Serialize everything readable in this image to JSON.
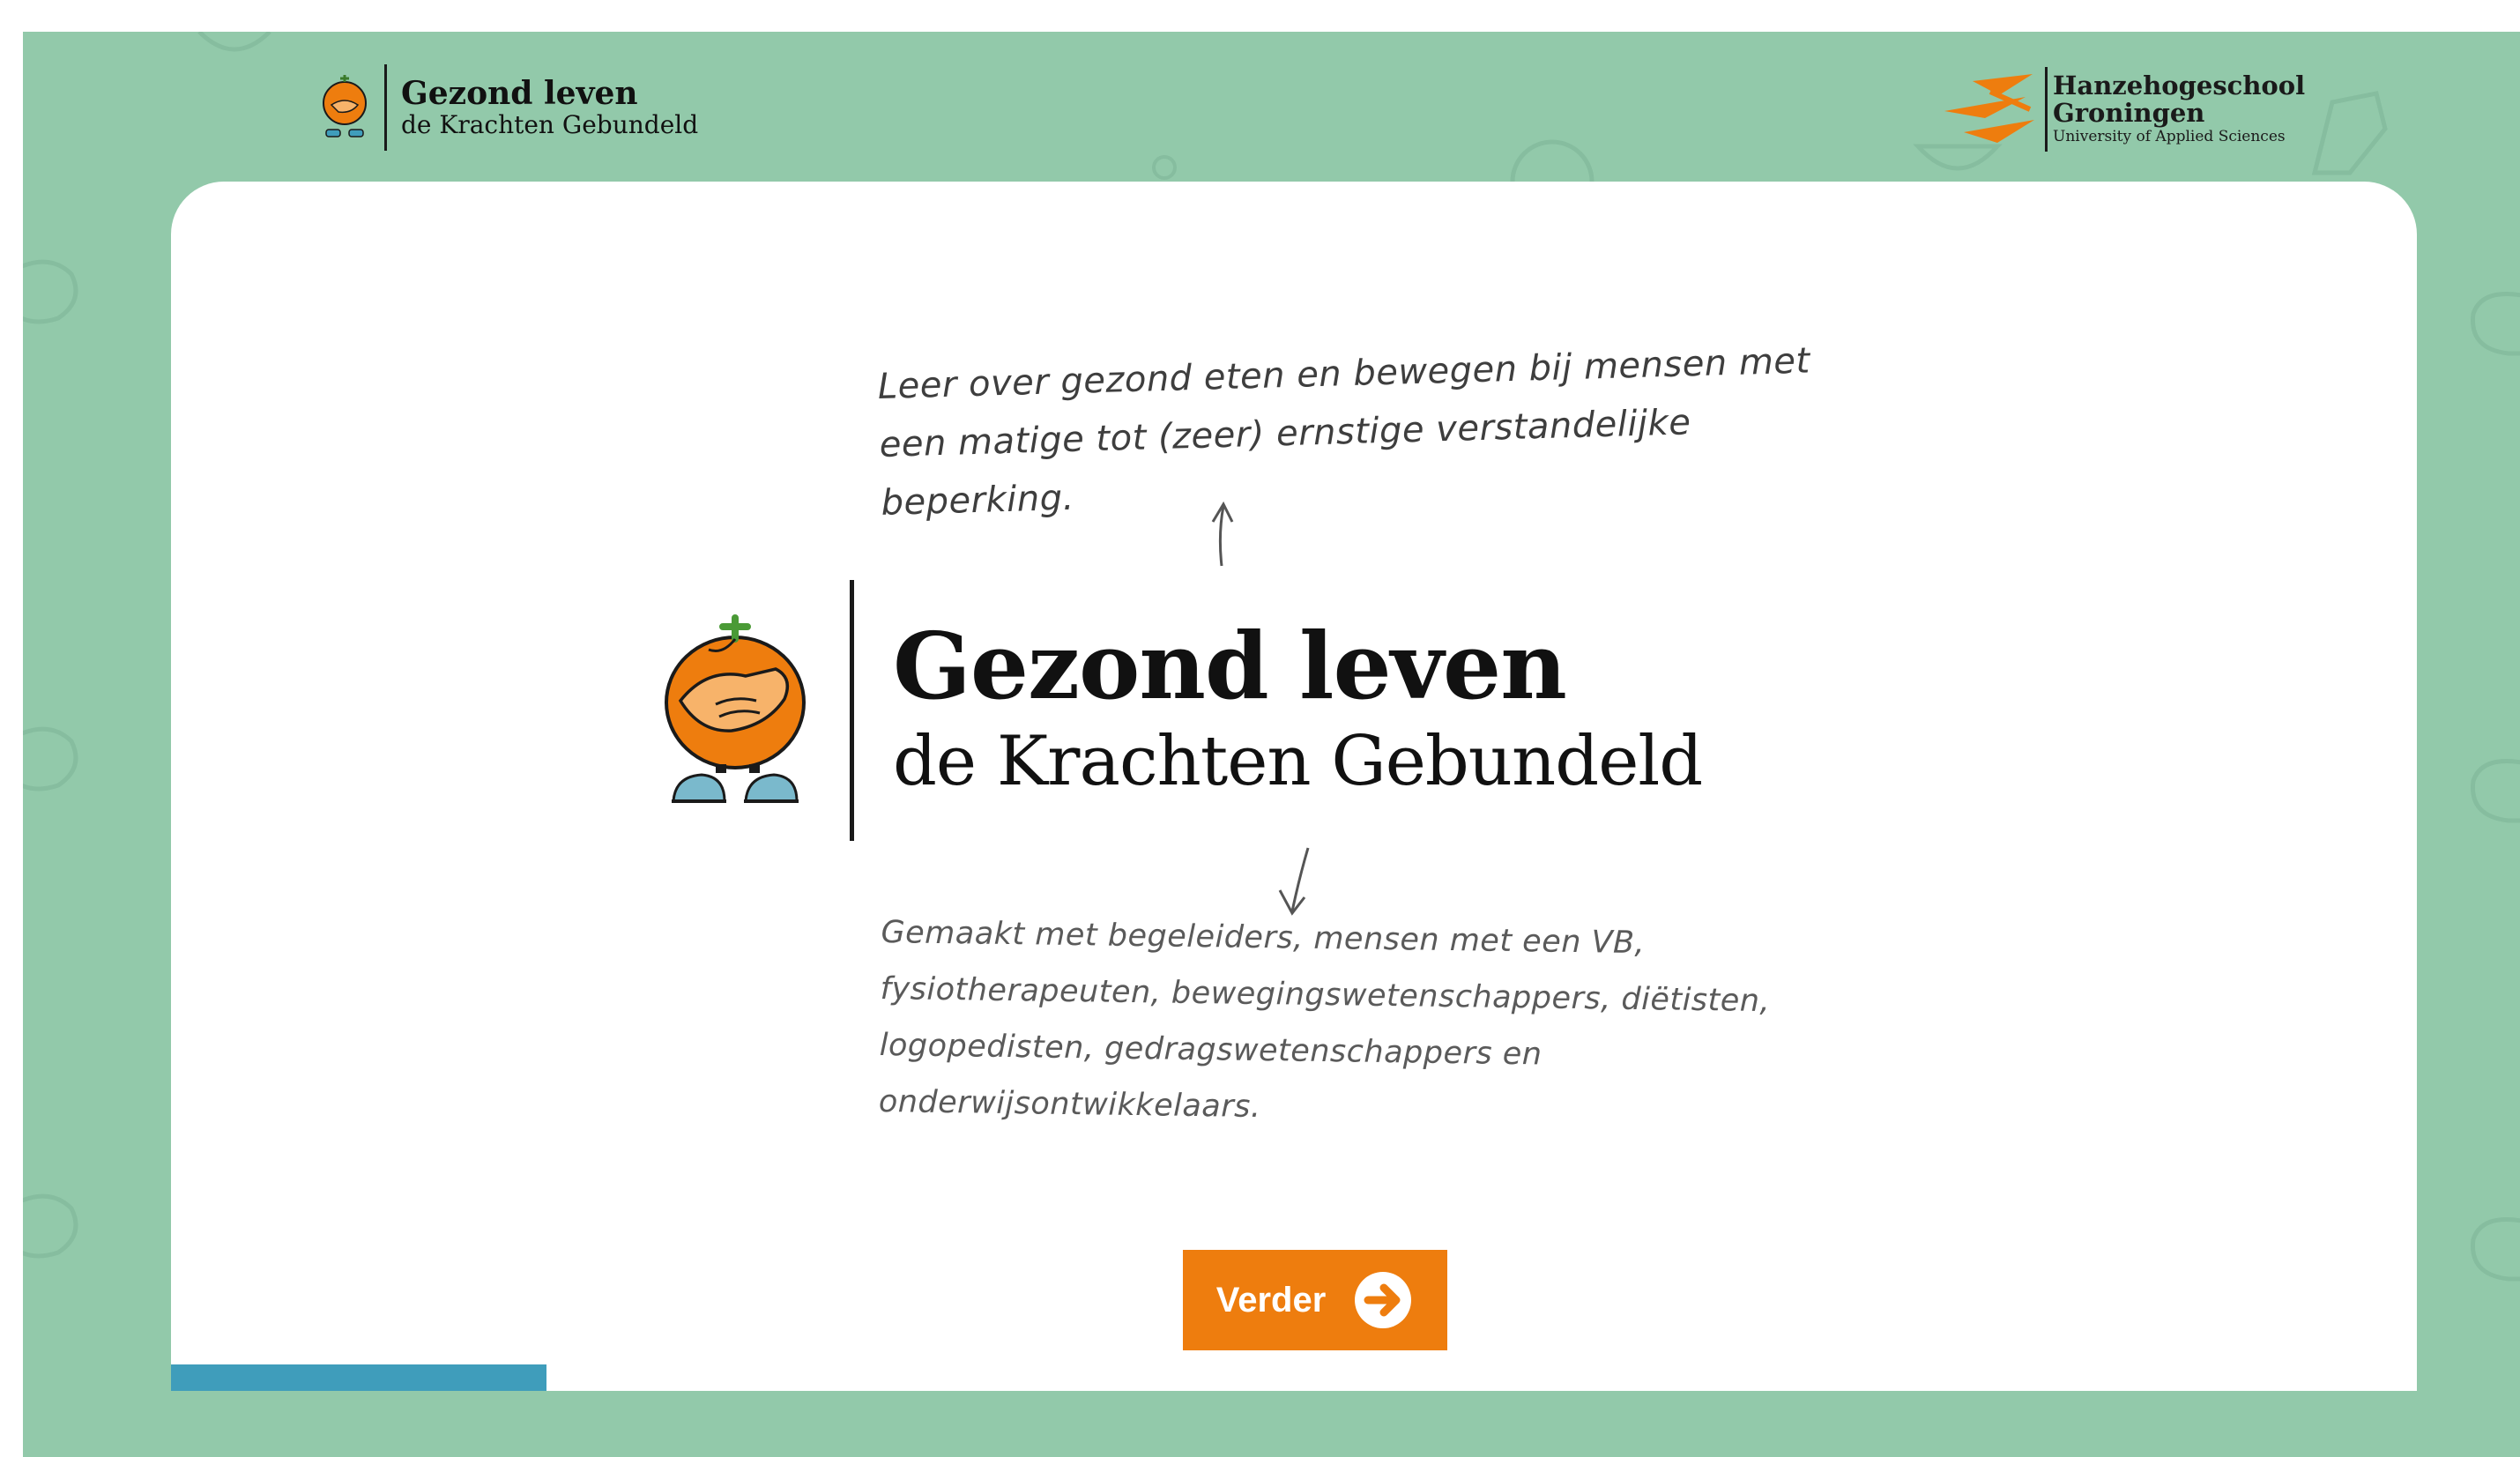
{
  "header": {
    "logo_title": "Gezond leven",
    "logo_subtitle": "de Krachten Gebundeld",
    "partner_line1": "Hanzehogeschool",
    "partner_line2": "Groningen",
    "partner_line3": "University of Applied Sciences"
  },
  "intro": {
    "note_top": "Leer over gezond eten en bewegen bij mensen met een matige tot (zeer) ernstige verstandelijke beperking.",
    "title": "Gezond leven",
    "subtitle": "de Krachten Gebundeld",
    "note_bottom": "Gemaakt met begeleiders, mensen met een VB, fysiotherapeuten, bewegingswetenschappers, diëtisten, logopedisten, gedragswetenschappers en onderwijsontwikkelaars."
  },
  "button": {
    "label": "Verder",
    "icon": "arrow-right-circle-icon"
  },
  "progress": {
    "fraction": 0.167
  },
  "colors": {
    "background": "#92c9aa",
    "accent": "#ee7d0e",
    "progress": "#3f9dbb",
    "card": "#ffffff"
  }
}
